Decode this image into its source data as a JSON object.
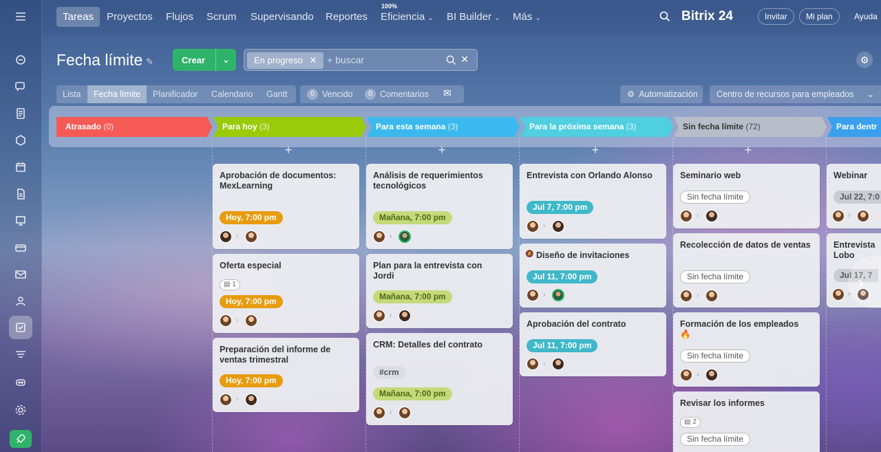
{
  "topnav": {
    "items": [
      "Tareas",
      "Proyectos",
      "Flujos",
      "Scrum",
      "Supervisando",
      "Reportes",
      "Eficiencia",
      "BI Builder",
      "Más"
    ],
    "efficiency_badge": "100%",
    "logo": "Bitrix 24",
    "invite": "Invitar",
    "plan": "Mi plan",
    "help": "Ayuda"
  },
  "page": {
    "title": "Fecha límite",
    "create": "Crear",
    "filter_chip": "En progreso",
    "search_placeholder": "+ buscar"
  },
  "views": [
    "Lista",
    "Fecha límite",
    "Planificador",
    "Calendario",
    "Gantt"
  ],
  "counters": {
    "overdue_count": "0",
    "overdue": "Vencido",
    "comments_count": "0",
    "comments": "Comentarios"
  },
  "automation": "Automatización",
  "resource_center": "Centro de recursos para empleados",
  "columns": [
    {
      "title": "Atrasado",
      "count": "(0)",
      "color": "#f55a55"
    },
    {
      "title": "Para hoy",
      "count": "(3)",
      "color": "#9acb08"
    },
    {
      "title": "Para esta semana",
      "count": "(3)",
      "color": "#3bb9ee"
    },
    {
      "title": "Para la próxima semana",
      "count": "(3)",
      "color": "#4fcfe0"
    },
    {
      "title": "Sin fecha límite",
      "count": "(72)",
      "color": "#aab0bd"
    },
    {
      "title": "Para dentr",
      "count": "",
      "color": "#3aa0ee"
    }
  ],
  "cards": {
    "hoy": [
      {
        "title": "Aprobación de documentos: MexLearning",
        "deadline": "Hoy, 7:00 pm"
      },
      {
        "title": "Oferta especial",
        "checklist": "1",
        "deadline": "Hoy, 7:00 pm"
      },
      {
        "title": "Preparación del informe de ventas trimestral",
        "deadline": "Hoy, 7:00 pm"
      }
    ],
    "semana": [
      {
        "title": "Análisis de requerimientos tecnológicos",
        "deadline": "Mañana, 7:00 pm"
      },
      {
        "title": "Plan para la entrevista con Jordi",
        "deadline": "Mañana, 7:00 pm"
      },
      {
        "title": "CRM: Detalles del contrato",
        "tag": "#crm",
        "deadline": "Mañana, 7:00 pm"
      }
    ],
    "proxima": [
      {
        "title": "Entrevista con Orlando Alonso",
        "deadline": "Jul 7, 7:00 pm"
      },
      {
        "title": "Diseño de invitaciones",
        "deadline": "Jul 11, 7:00 pm"
      },
      {
        "title": "Aprobación del contrato",
        "deadline": "Jul 11, 7:00 pm"
      }
    ],
    "sin": [
      {
        "title": "Seminario web",
        "deadline": "Sin fecha límite"
      },
      {
        "title": "Recolección de datos de ventas",
        "deadline": "Sin fecha límite"
      },
      {
        "title": "Formación de los empleados",
        "deadline": "Sin fecha límite"
      },
      {
        "title": "Revisar los informes",
        "checklist": "2",
        "deadline": "Sin fecha límite"
      }
    ],
    "dentro": [
      {
        "title": "Webinar",
        "deadline": "Jul 22, 7:0"
      },
      {
        "title": "Entrevista Lobo",
        "deadline": "Jul 17, 7"
      }
    ]
  }
}
